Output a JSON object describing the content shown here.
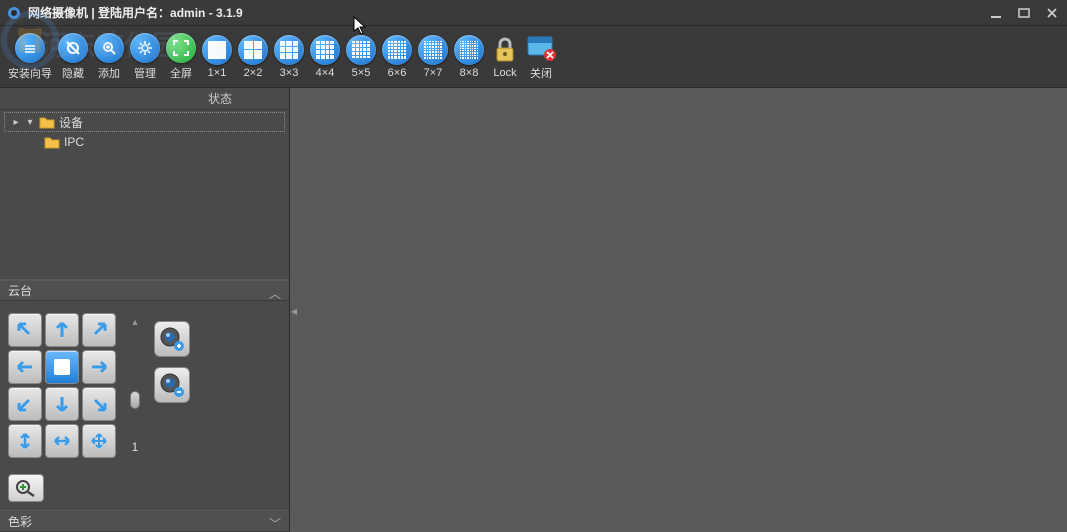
{
  "title": "网络摄像机 | 登陆用户名：admin - 3.1.9",
  "watermark": "河东软件园",
  "toolbar": {
    "install": "安装向导",
    "hide": "隐藏",
    "add": "添加",
    "manage": "管理",
    "fullscreen": "全屏",
    "g1": "1×1",
    "g2": "2×2",
    "g3": "3×3",
    "g4": "4×4",
    "g5": "5×5",
    "g6": "6×6",
    "g7": "7×7",
    "g8": "8×8",
    "lock": "Lock",
    "close": "关闭"
  },
  "tree": {
    "header_status": "状态",
    "root": "设备",
    "child": "IPC"
  },
  "ptz": {
    "title": "云台",
    "speed": "1"
  },
  "color": {
    "title": "色彩"
  }
}
